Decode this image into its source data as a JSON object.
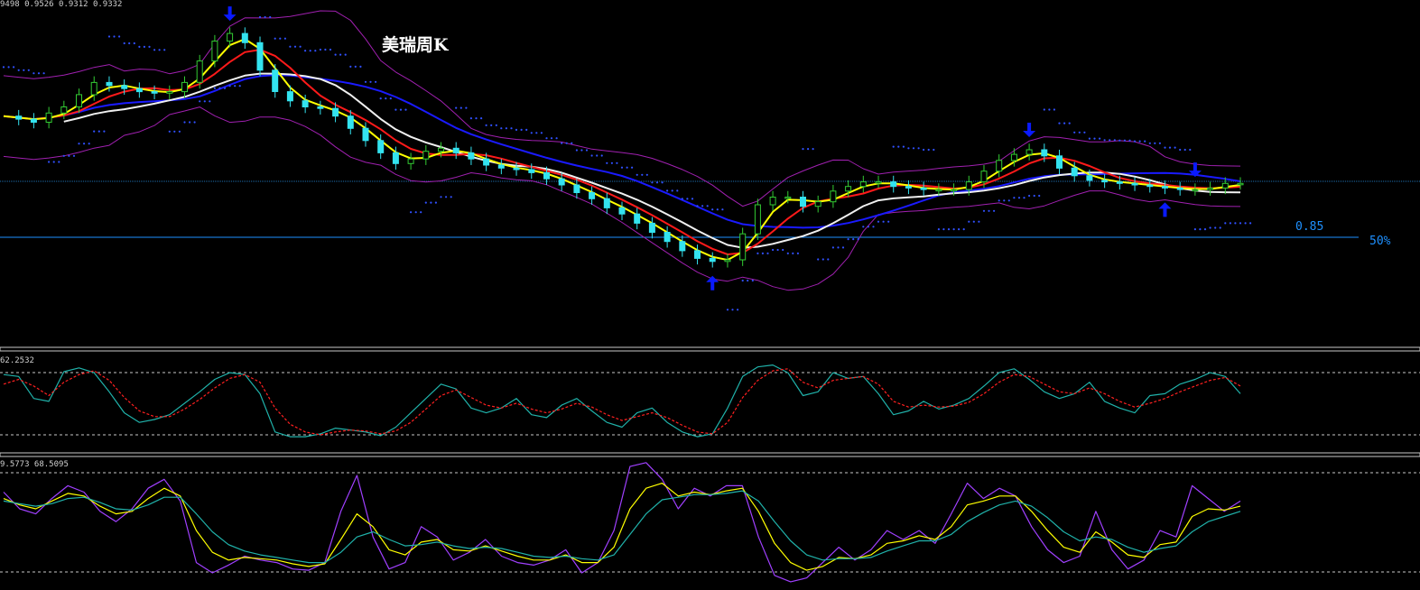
{
  "title": "美瑞周K",
  "main_header": "9498 0.9526 0.9312 0.9332",
  "osc1_header": "62.2532",
  "osc2_header": "9.5773 68.5095",
  "level_label": "0.85",
  "fib_label": "50%",
  "colors": {
    "background": "#000000",
    "candle_up": "#33cc33",
    "candle_down": "#33e3f0",
    "ma_fast": "#ffff00",
    "ma_mid": "#ff1a1a",
    "ma_slow": "#f0f0f0",
    "ma_long": "#1a1aff",
    "band": "#a020b0",
    "sar": "#3050ff",
    "signal_arrow": "#0a1aff",
    "level_line": "#1e90ff",
    "kdj_k": "#20b2aa",
    "kdj_d": "#ff2020",
    "osc_fast": "#a040ff",
    "osc_mid": "#ffff00",
    "osc_slow": "#20b2aa"
  },
  "chart_data": [
    {
      "type": "candlestick",
      "title": "美瑞周K",
      "ylim": [
        0.78,
        1.0
      ],
      "series": [
        {
          "name": "close",
          "values": [
            0.93,
            0.928,
            0.926,
            0.932,
            0.936,
            0.944,
            0.952,
            0.95,
            0.948,
            0.946,
            0.945,
            0.946,
            0.952,
            0.966,
            0.979,
            0.984,
            0.978,
            0.96,
            0.946,
            0.94,
            0.936,
            0.935,
            0.93,
            0.922,
            0.914,
            0.906,
            0.899,
            0.902,
            0.907,
            0.909,
            0.906,
            0.902,
            0.898,
            0.896,
            0.895,
            0.893,
            0.889,
            0.885,
            0.88,
            0.876,
            0.87,
            0.866,
            0.86,
            0.854,
            0.848,
            0.842,
            0.837,
            0.835,
            0.836,
            0.853,
            0.872,
            0.877,
            0.877,
            0.871,
            0.874,
            0.881,
            0.884,
            0.887,
            0.887,
            0.884,
            0.883,
            0.882,
            0.882,
            0.882,
            0.887,
            0.894,
            0.901,
            0.905,
            0.908,
            0.904,
            0.896,
            0.891,
            0.888,
            0.887,
            0.886,
            0.885,
            0.884,
            0.883,
            0.882,
            0.882,
            0.883,
            0.886,
            0.886
          ]
        }
      ]
    },
    {
      "type": "line",
      "ylim": [
        0,
        100
      ],
      "series": [
        {
          "name": "",
          "values": [
            80,
            78,
            55,
            52,
            83,
            87,
            82,
            62,
            40,
            30,
            33,
            38,
            50,
            62,
            75,
            82,
            80,
            60,
            20,
            15,
            15,
            18,
            24,
            22,
            20,
            16,
            25,
            40,
            55,
            70,
            65,
            45,
            40,
            45,
            55,
            38,
            35,
            48,
            55,
            42,
            30,
            25,
            40,
            45,
            30,
            20,
            15,
            18,
            45,
            78,
            88,
            90,
            82,
            58,
            62,
            82,
            76,
            78,
            60,
            38,
            42,
            52,
            44,
            48,
            55,
            68,
            82,
            86,
            75,
            62,
            55,
            60,
            72,
            52,
            45,
            40,
            58,
            60,
            70,
            75,
            82,
            78,
            60
          ]
        },
        {
          "name": "",
          "values": [
            70,
            75,
            68,
            58,
            72,
            80,
            84,
            74,
            56,
            42,
            36,
            36,
            44,
            54,
            66,
            76,
            80,
            72,
            45,
            28,
            20,
            17,
            20,
            22,
            21,
            18,
            21,
            30,
            44,
            58,
            64,
            56,
            48,
            45,
            50,
            44,
            40,
            44,
            50,
            46,
            38,
            32,
            36,
            40,
            35,
            27,
            20,
            18,
            30,
            56,
            74,
            84,
            86,
            72,
            66,
            74,
            76,
            78,
            70,
            52,
            46,
            48,
            46,
            47,
            51,
            60,
            72,
            80,
            78,
            70,
            62,
            60,
            66,
            60,
            52,
            46,
            50,
            55,
            62,
            68,
            74,
            77,
            68
          ]
        }
      ]
    },
    {
      "type": "line",
      "ylim": [
        0,
        100
      ],
      "series": [
        {
          "name": "",
          "values": [
            75,
            62,
            58,
            70,
            80,
            75,
            60,
            52,
            62,
            78,
            85,
            68,
            20,
            12,
            18,
            25,
            22,
            20,
            15,
            14,
            20,
            60,
            88,
            40,
            15,
            20,
            48,
            40,
            22,
            28,
            38,
            25,
            20,
            18,
            22,
            30,
            12,
            20,
            45,
            95,
            98,
            85,
            62,
            78,
            72,
            80,
            80,
            40,
            10,
            5,
            8,
            20,
            32,
            22,
            30,
            45,
            38,
            45,
            35,
            58,
            82,
            70,
            78,
            72,
            48,
            30,
            20,
            25,
            60,
            30,
            15,
            22,
            45,
            40,
            80,
            70,
            60,
            68
          ]
        },
        {
          "name": "",
          "values": [
            70,
            65,
            62,
            68,
            74,
            72,
            64,
            58,
            60,
            70,
            78,
            72,
            45,
            28,
            22,
            24,
            23,
            22,
            19,
            17,
            19,
            38,
            58,
            48,
            30,
            26,
            36,
            38,
            30,
            29,
            33,
            29,
            25,
            22,
            22,
            26,
            20,
            20,
            32,
            62,
            78,
            82,
            72,
            75,
            73,
            76,
            78,
            60,
            35,
            20,
            14,
            17,
            24,
            23,
            26,
            35,
            37,
            41,
            38,
            48,
            65,
            68,
            72,
            72,
            60,
            45,
            32,
            28,
            44,
            36,
            26,
            24,
            34,
            36,
            56,
            62,
            61,
            64
          ]
        },
        {
          "name": "",
          "values": [
            68,
            66,
            64,
            66,
            70,
            71,
            67,
            62,
            61,
            65,
            71,
            71,
            58,
            44,
            34,
            29,
            26,
            24,
            22,
            20,
            20,
            28,
            40,
            44,
            38,
            33,
            34,
            36,
            33,
            31,
            32,
            31,
            28,
            25,
            24,
            25,
            23,
            22,
            26,
            42,
            58,
            69,
            71,
            73,
            73,
            74,
            76,
            68,
            52,
            37,
            26,
            22,
            23,
            23,
            24,
            29,
            33,
            37,
            37,
            42,
            52,
            59,
            65,
            68,
            64,
            55,
            44,
            37,
            40,
            38,
            32,
            28,
            31,
            33,
            44,
            52,
            56,
            60
          ]
        }
      ]
    }
  ]
}
